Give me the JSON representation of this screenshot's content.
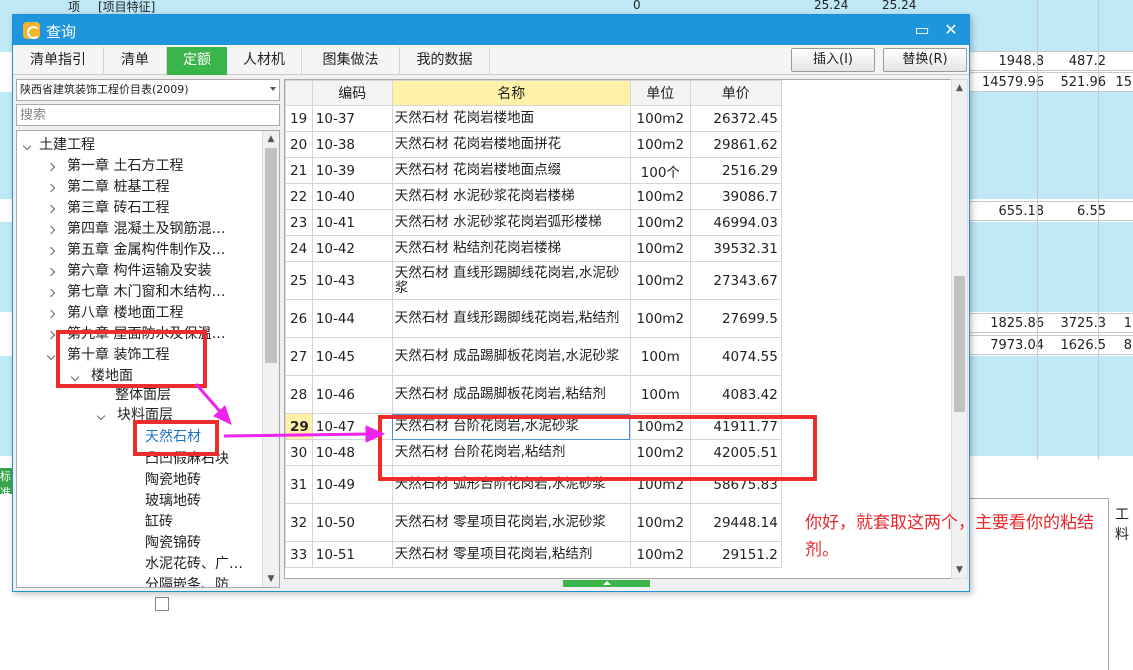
{
  "background": {
    "top_row": [
      "项",
      "[项目特征]",
      "0",
      "25.24",
      "25.24"
    ],
    "rows": [
      {
        "a": "1948.8",
        "b": "487.2",
        "c": ""
      },
      {
        "a": "14579.96",
        "b": "521.96",
        "c": "15"
      },
      {
        "a": "655.18",
        "b": "6.55",
        "c": ""
      },
      {
        "a": "1825.86",
        "b": "3725.3",
        "c": "1"
      },
      {
        "a": "7973.04",
        "b": "1626.5",
        "c": "8"
      }
    ],
    "side_tab": "标准",
    "right_panel_label": "工料"
  },
  "dialog": {
    "title": "查询",
    "minimize_symbol": "▭",
    "close_symbol": "✕",
    "tabs": [
      {
        "label": "清单指引",
        "active": false
      },
      {
        "label": "清单",
        "active": false
      },
      {
        "label": "定额",
        "active": true
      },
      {
        "label": "人材机",
        "active": false
      },
      {
        "label": "图集做法",
        "active": false
      },
      {
        "label": "我的数据",
        "active": false
      }
    ],
    "insert_button": "插入(I)",
    "replace_button": "替换(R)"
  },
  "library": {
    "selected": "陕西省建筑装饰工程价目表(2009)",
    "search_placeholder": "搜索"
  },
  "tree": {
    "root": "土建工程",
    "chapters": [
      "第一章 土石方工程",
      "第二章 桩基工程",
      "第三章 砖石工程",
      "第四章 混凝土及钢筋混…",
      "第五章 金属构件制作及…",
      "第六章 构件运输及安装",
      "第七章 木门窗和木结构…",
      "第八章 楼地面工程",
      "第九章 屋面防水及保温…"
    ],
    "expanded_chapter": "第十章 装饰工程",
    "floor_node": "楼地面",
    "subnodes": [
      "整体面层",
      "块料面层"
    ],
    "selected_leaf": "天然石材",
    "leaves": [
      "凸凹假麻石块",
      "陶瓷地砖",
      "玻璃地砖",
      "缸砖",
      "陶瓷锦砖",
      "水泥花砖、广…",
      "分隔嵌条、防…"
    ]
  },
  "grid": {
    "headers": {
      "code": "编码",
      "name": "名称",
      "unit": "单位",
      "price": "单价"
    },
    "rows": [
      {
        "idx": "19",
        "code": "10-37",
        "name": "天然石材 花岗岩楼地面",
        "unit": "100m2",
        "price": "26372.45"
      },
      {
        "idx": "20",
        "code": "10-38",
        "name": "天然石材 花岗岩楼地面拼花",
        "unit": "100m2",
        "price": "29861.62"
      },
      {
        "idx": "21",
        "code": "10-39",
        "name": "天然石材 花岗岩楼地面点缀",
        "unit": "100个",
        "price": "2516.29"
      },
      {
        "idx": "22",
        "code": "10-40",
        "name": "天然石材 水泥砂浆花岗岩楼梯",
        "unit": "100m2",
        "price": "39086.7"
      },
      {
        "idx": "23",
        "code": "10-41",
        "name": "天然石材 水泥砂浆花岗岩弧形楼梯",
        "unit": "100m2",
        "price": "46994.03"
      },
      {
        "idx": "24",
        "code": "10-42",
        "name": "天然石材 粘结剂花岗岩楼梯",
        "unit": "100m2",
        "price": "39532.31"
      },
      {
        "idx": "25",
        "code": "10-43",
        "name": "天然石材 直线形踢脚线花岗岩,水泥砂浆",
        "unit": "100m2",
        "price": "27343.67"
      },
      {
        "idx": "26",
        "code": "10-44",
        "name": "天然石材 直线形踢脚线花岗岩,粘结剂",
        "unit": "100m2",
        "price": "27699.5"
      },
      {
        "idx": "27",
        "code": "10-45",
        "name": "天然石材 成品踢脚板花岗岩,水泥砂浆",
        "unit": "100m",
        "price": "4074.55"
      },
      {
        "idx": "28",
        "code": "10-46",
        "name": "天然石材 成品踢脚板花岗岩,粘结剂",
        "unit": "100m",
        "price": "4083.42"
      },
      {
        "idx": "29",
        "code": "10-47",
        "name": "天然石材 台阶花岗岩,水泥砂浆",
        "unit": "100m2",
        "price": "41911.77"
      },
      {
        "idx": "30",
        "code": "10-48",
        "name": "天然石材 台阶花岗岩,粘结剂",
        "unit": "100m2",
        "price": "42005.51"
      },
      {
        "idx": "31",
        "code": "10-49",
        "name": "天然石材 弧形台阶花岗岩,水泥砂浆",
        "unit": "100m2",
        "price": "58675.83"
      },
      {
        "idx": "32",
        "code": "10-50",
        "name": "天然石材 零星项目花岗岩,水泥砂浆",
        "unit": "100m2",
        "price": "29448.14"
      },
      {
        "idx": "33",
        "code": "10-51",
        "name": "天然石材 零星项目花岗岩,粘结剂",
        "unit": "100m2",
        "price": "29151.2"
      }
    ],
    "current_row": "29"
  },
  "annotation": {
    "note": "你好，就套取这两个，主要看你的粘结剂。",
    "color": "#e8262b",
    "arrow_color": "#ee22ee"
  },
  "colors": {
    "titlebar": "#1e95dc",
    "active_tab": "#39b54a",
    "header_highlight": "#fff2a8",
    "highlight_box": "#ee2c2c"
  }
}
